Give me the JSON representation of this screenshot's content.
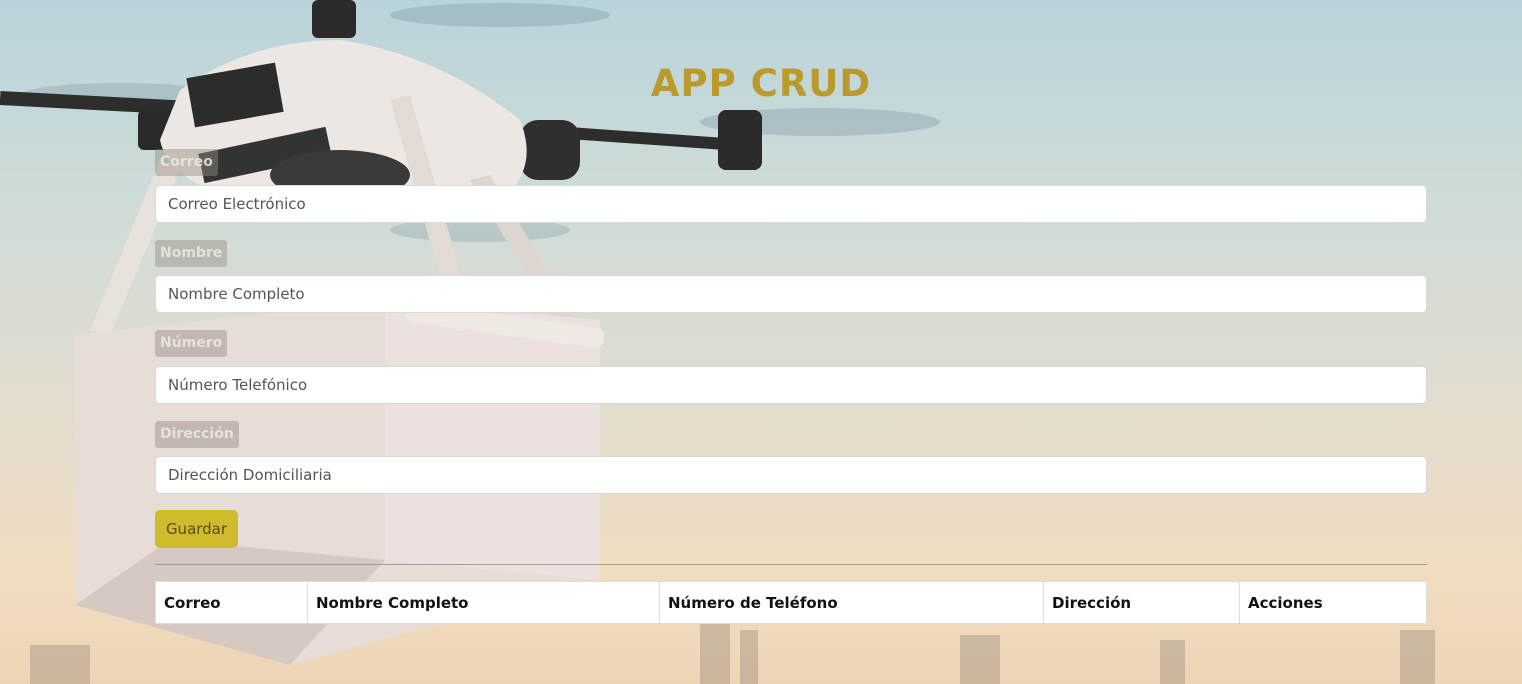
{
  "app": {
    "title": "APP CRUD"
  },
  "form": {
    "fields": [
      {
        "label": "Correo",
        "placeholder": "Correo Electrónico"
      },
      {
        "label": "Nombre",
        "placeholder": "Nombre Completo"
      },
      {
        "label": "Número",
        "placeholder": "Número Telefónico"
      },
      {
        "label": "Dirección",
        "placeholder": "Dirección Domiciliaria"
      }
    ],
    "save_label": "Guardar"
  },
  "table": {
    "columns": [
      "Correo",
      "Nombre Completo",
      "Número de Teléfono",
      "Dirección",
      "Acciones"
    ]
  },
  "colors": {
    "title": "#b99a2a",
    "save_button": "#cfbb2b"
  }
}
